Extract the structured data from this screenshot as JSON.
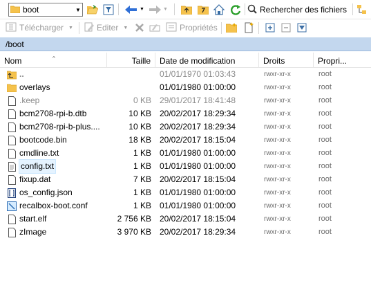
{
  "toolbar1": {
    "path_value": "boot",
    "search_label": "Rechercher des fichiers"
  },
  "toolbar2": {
    "download_label": "Télécharger",
    "edit_label": "Editer",
    "properties_label": "Propriétés"
  },
  "address": "/boot",
  "columns": {
    "name": "Nom",
    "size": "Taille",
    "date": "Date de modification",
    "rights": "Droits",
    "owner": "Propri..."
  },
  "files": [
    {
      "name": "..",
      "size": "",
      "date": "01/01/1970 01:03:43",
      "rights": "rwxr-xr-x",
      "owner": "root",
      "icon": "parent-folder-icon"
    },
    {
      "name": "overlays",
      "size": "",
      "date": "01/01/1980 01:00:00",
      "rights": "rwxr-xr-x",
      "owner": "root",
      "icon": "folder-icon"
    },
    {
      "name": ".keep",
      "size": "0 KB",
      "date": "29/01/2017 18:41:48",
      "rights": "rwxr-xr-x",
      "owner": "root",
      "icon": "file-icon"
    },
    {
      "name": "bcm2708-rpi-b.dtb",
      "size": "10 KB",
      "date": "20/02/2017 18:29:34",
      "rights": "rwxr-xr-x",
      "owner": "root",
      "icon": "file-icon"
    },
    {
      "name": "bcm2708-rpi-b-plus....",
      "size": "10 KB",
      "date": "20/02/2017 18:29:34",
      "rights": "rwxr-xr-x",
      "owner": "root",
      "icon": "file-icon"
    },
    {
      "name": "bootcode.bin",
      "size": "18 KB",
      "date": "20/02/2017 18:15:04",
      "rights": "rwxr-xr-x",
      "owner": "root",
      "icon": "file-icon"
    },
    {
      "name": "cmdline.txt",
      "size": "1 KB",
      "date": "01/01/1980 01:00:00",
      "rights": "rwxr-xr-x",
      "owner": "root",
      "icon": "file-icon"
    },
    {
      "name": "config.txt",
      "size": "1 KB",
      "date": "01/01/1980 01:00:00",
      "rights": "rwxr-xr-x",
      "owner": "root",
      "icon": "text-file-icon"
    },
    {
      "name": "fixup.dat",
      "size": "7 KB",
      "date": "20/02/2017 18:15:04",
      "rights": "rwxr-xr-x",
      "owner": "root",
      "icon": "file-icon"
    },
    {
      "name": "os_config.json",
      "size": "1 KB",
      "date": "01/01/1980 01:00:00",
      "rights": "rwxr-xr-x",
      "owner": "root",
      "icon": "json-file-icon"
    },
    {
      "name": "recalbox-boot.conf",
      "size": "1 KB",
      "date": "01/01/1980 01:00:00",
      "rights": "rwxr-xr-x",
      "owner": "root",
      "icon": "config-file-icon"
    },
    {
      "name": "start.elf",
      "size": "2 756 KB",
      "date": "20/02/2017 18:15:04",
      "rights": "rwxr-xr-x",
      "owner": "root",
      "icon": "file-icon"
    },
    {
      "name": "zImage",
      "size": "3 970 KB",
      "date": "20/02/2017 18:29:34",
      "rights": "rwxr-xr-x",
      "owner": "root",
      "icon": "file-icon"
    }
  ],
  "colors": {
    "address_bar": "#c3d7ee",
    "folder": "#f5c24c",
    "selection": "#e5f3ff",
    "muted_text": "#8a8a8a"
  }
}
